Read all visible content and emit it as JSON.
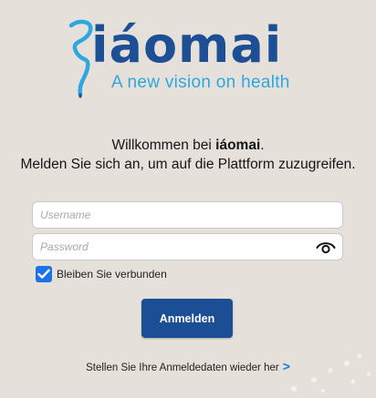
{
  "logo": {
    "wordmark": "iáomai",
    "tagline": "A new vision on health",
    "colors": {
      "primary": "#1d4f95",
      "secondary": "#2ea7df"
    },
    "icon": "serpent-staff-icon"
  },
  "welcome": {
    "prefix": "Willkommen bei ",
    "brand": "iáomai",
    "suffix": ".",
    "line2": "Melden Sie sich an, um auf die Plattform zuzugreifen."
  },
  "form": {
    "username_placeholder": "Username",
    "username_value": "",
    "password_placeholder": "Password",
    "password_value": "",
    "password_toggle_icon": "eye-icon",
    "remember_label": "Bleiben Sie verbunden",
    "remember_checked": true,
    "login_label": "Anmelden",
    "restore_label": "Stellen Sie Ihre Anmeldedaten wieder her",
    "restore_chevron": ">"
  },
  "colors": {
    "background": "#e6e0db",
    "button": "#1b4e95",
    "checkbox": "#1a73e8",
    "link_chevron": "#1a73e8"
  }
}
